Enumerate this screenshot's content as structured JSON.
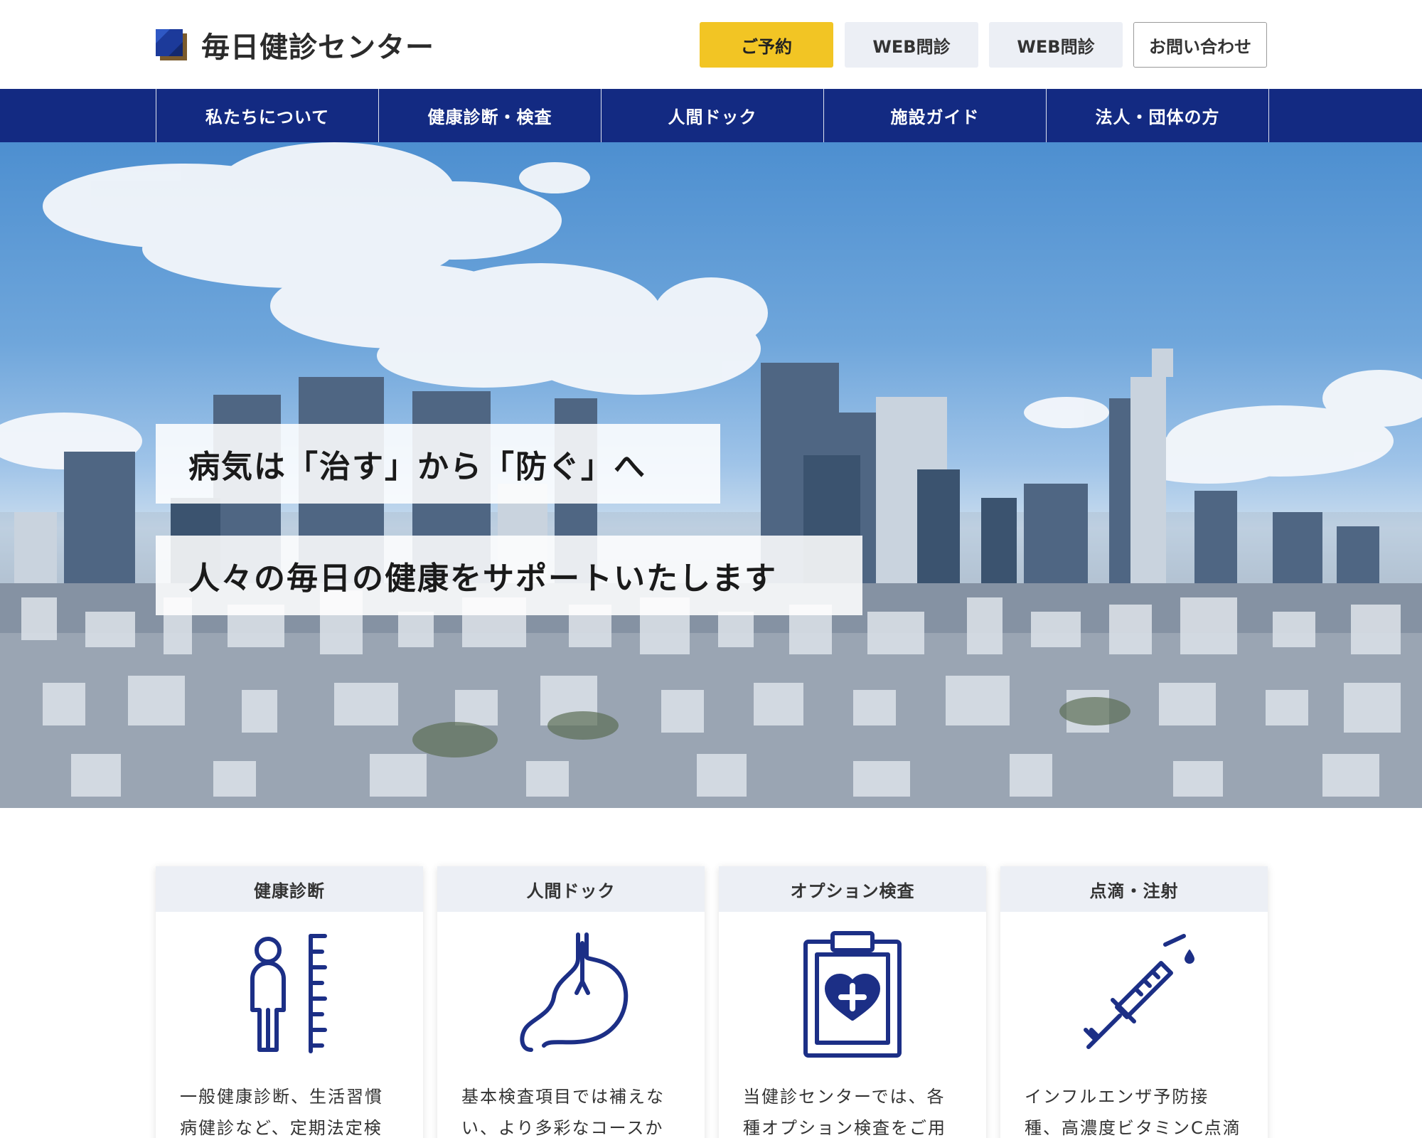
{
  "header": {
    "site_name": "毎日健診センター",
    "buttons": {
      "reserve": "ご予約",
      "web_interview_1": "WEB問診",
      "web_interview_2": "WEB問診",
      "contact": "お問い合わせ"
    }
  },
  "nav": {
    "items": [
      {
        "label": "私たちについて"
      },
      {
        "label": "健康診断・検査"
      },
      {
        "label": "人間ドック"
      },
      {
        "label": "施設ガイド"
      },
      {
        "label": "法人・団体の方"
      }
    ]
  },
  "hero": {
    "catch_1": "病気は「治す」から「防ぐ」へ",
    "catch_2": "人々の毎日の健康をサポートいたします"
  },
  "cards": [
    {
      "title": "健康診断",
      "icon": "body-measure-icon",
      "text": "一般健康診断、生活習慣病健診など、定期法定検査項"
    },
    {
      "title": "人間ドック",
      "icon": "stomach-icon",
      "text": "基本検査項目では補えない、より多彩なコースから"
    },
    {
      "title": "オプション検査",
      "icon": "medical-chart-icon",
      "text": "当健診センターでは、各種オプション検査をご用意し"
    },
    {
      "title": "点滴・注射",
      "icon": "syringe-icon",
      "text": "インフルエンザ予防接種、高濃度ビタミンC点滴療法"
    }
  ],
  "colors": {
    "brand_navy": "#132a82",
    "reserve_yellow": "#f2c524",
    "soft_gray": "#eceff5",
    "icon_navy": "#1c2f86"
  }
}
